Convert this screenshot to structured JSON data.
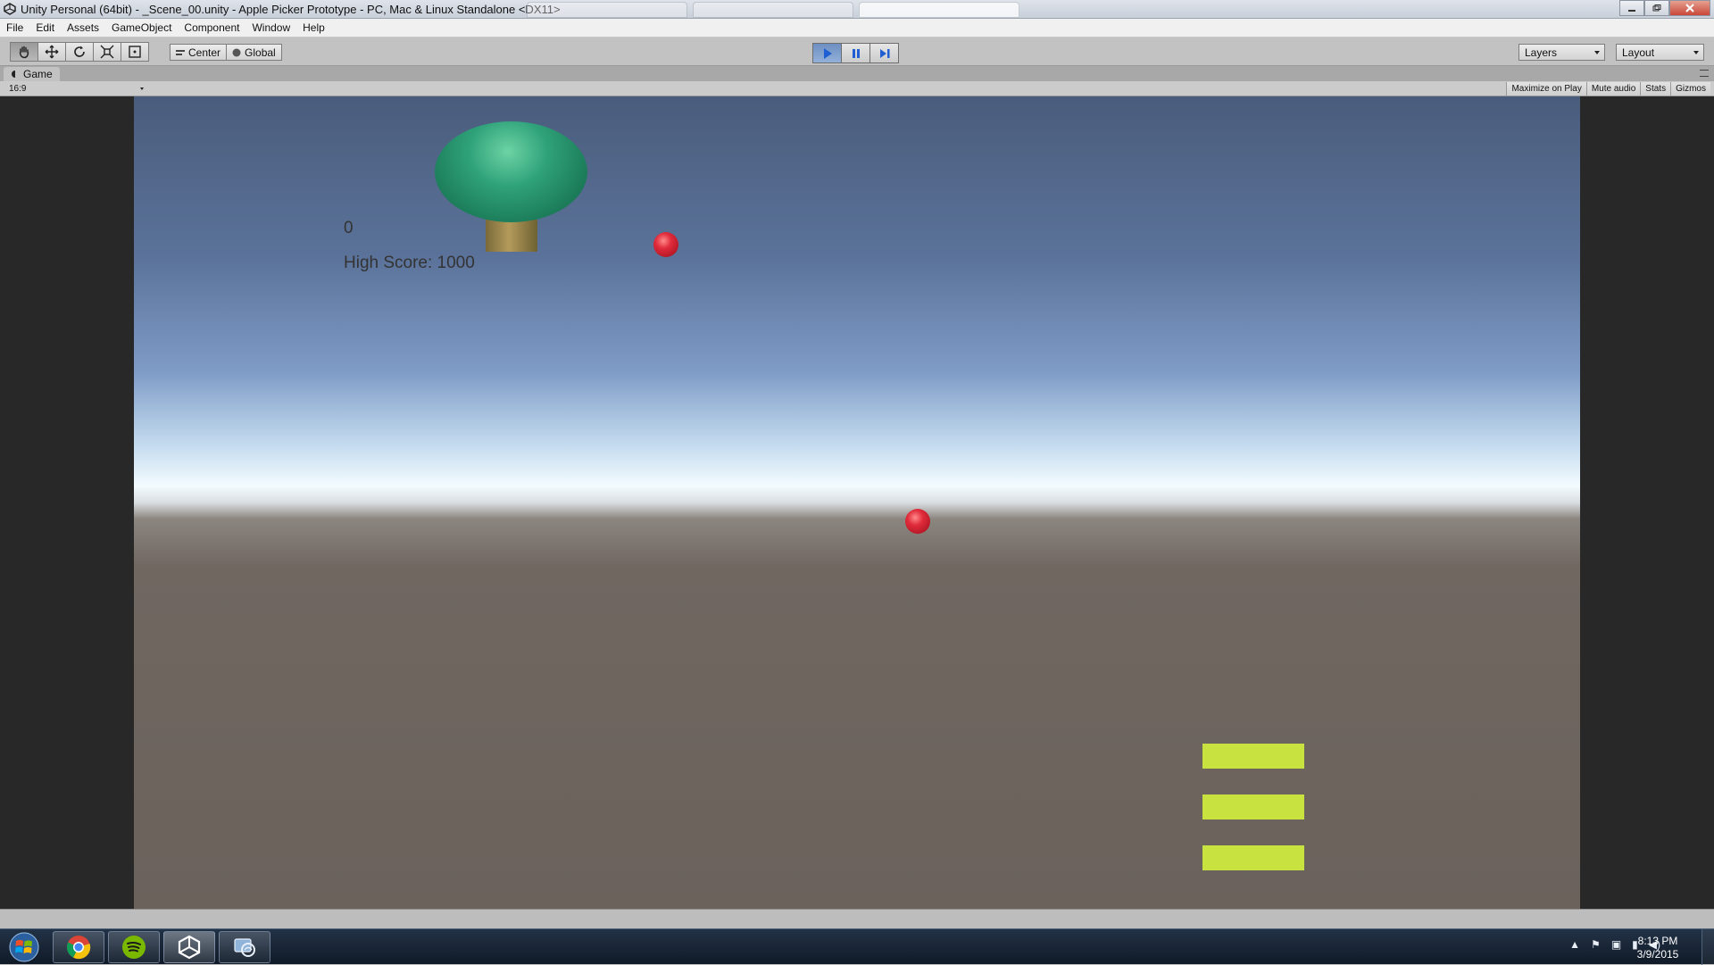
{
  "window": {
    "title": "Unity Personal (64bit) - _Scene_00.unity - Apple Picker Prototype - PC, Mac & Linux Standalone <DX11>",
    "controls": [
      "minimize",
      "maximize",
      "close"
    ]
  },
  "menu": {
    "items": [
      "File",
      "Edit",
      "Assets",
      "GameObject",
      "Component",
      "Window",
      "Help"
    ]
  },
  "toolbar": {
    "tools": [
      "hand-tool",
      "move-tool",
      "rotate-tool",
      "scale-tool",
      "rect-tool"
    ],
    "pivot_label": "Center",
    "space_label": "Global",
    "layers_label": "Layers",
    "layout_label": "Layout"
  },
  "game_panel": {
    "tab_label": "Game",
    "aspect": "16:9",
    "buttons": [
      "Maximize on Play",
      "Mute audio",
      "Stats",
      "Gizmos"
    ]
  },
  "game": {
    "score": "0",
    "high_score": "High Score: 1000",
    "apples_visible": 2,
    "baskets_visible": 3,
    "colors": {
      "sky_top": "#4a5c7c",
      "ground": "#6a625b",
      "tree": "#2fa27a",
      "apple": "#e02b3b",
      "basket": "#c8e33f"
    }
  },
  "taskbar": {
    "apps": [
      "chrome",
      "spotify",
      "unity",
      "connect"
    ],
    "time": "8:13 PM",
    "date": "3/9/2015"
  }
}
